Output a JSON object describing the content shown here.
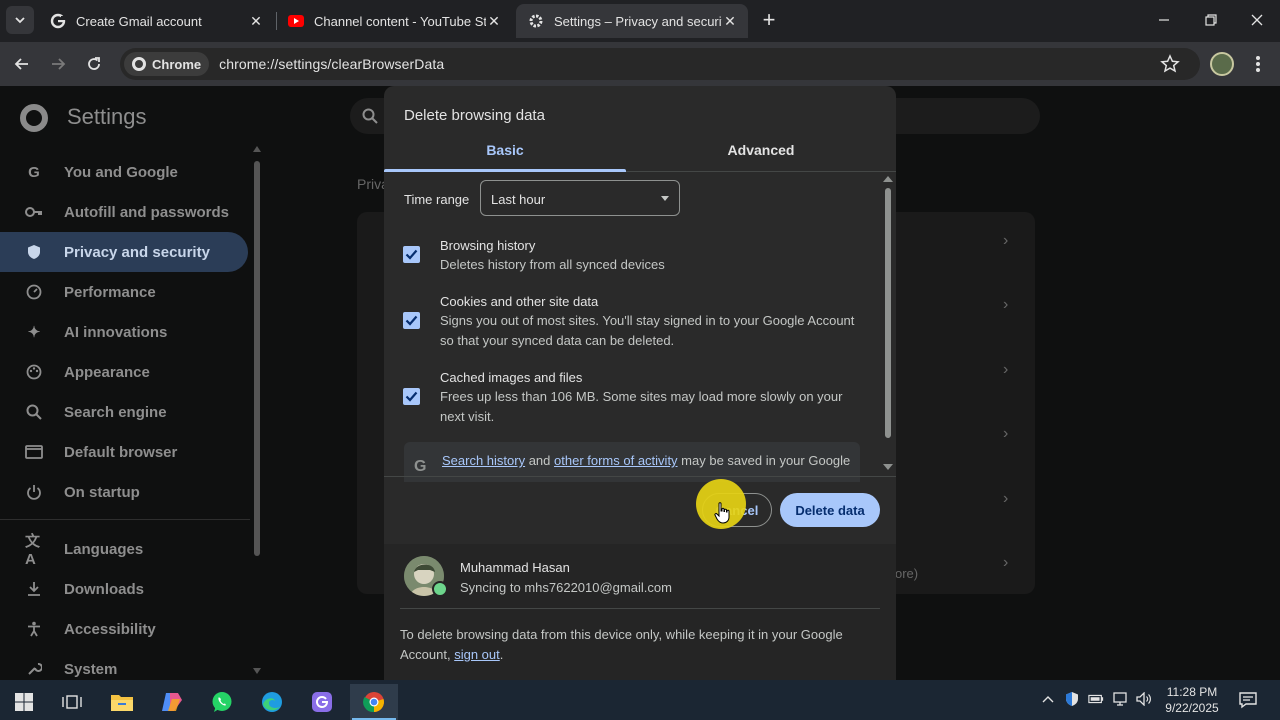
{
  "browser": {
    "tabs": [
      {
        "title": "Create Gmail account",
        "favicon": "google-g-icon",
        "active": false
      },
      {
        "title": "Channel content - YouTube Studio",
        "favicon": "youtube-icon",
        "active": false
      },
      {
        "title": "Settings – Privacy and security",
        "favicon": "gear-icon",
        "active": true
      }
    ],
    "chip_label": "Chrome",
    "url": "chrome://settings/clearBrowserData"
  },
  "settings": {
    "title": "Settings",
    "sidebar": [
      {
        "label": "You and Google",
        "icon": "google-g-icon"
      },
      {
        "label": "Autofill and passwords",
        "icon": "key-icon"
      },
      {
        "label": "Privacy and security",
        "icon": "shield-icon",
        "active": true
      },
      {
        "label": "Performance",
        "icon": "speedometer-icon"
      },
      {
        "label": "AI innovations",
        "icon": "sparkle-icon"
      },
      {
        "label": "Appearance",
        "icon": "palette-icon"
      },
      {
        "label": "Search engine",
        "icon": "search-icon"
      },
      {
        "label": "Default browser",
        "icon": "browser-window-icon"
      },
      {
        "label": "On startup",
        "icon": "power-icon"
      },
      {
        "label": "Languages",
        "icon": "translate-icon"
      },
      {
        "label": "Downloads",
        "icon": "download-icon"
      },
      {
        "label": "Accessibility",
        "icon": "accessibility-icon"
      },
      {
        "label": "System",
        "icon": "wrench-icon"
      }
    ],
    "section_heading_partial": "Priva",
    "card_more_partial": "ore)"
  },
  "dialog": {
    "title": "Delete browsing data",
    "tabs": {
      "basic": "Basic",
      "advanced": "Advanced"
    },
    "time_range_label": "Time range",
    "time_range_value": "Last hour",
    "options": [
      {
        "title": "Browsing history",
        "description": "Deletes history from all synced devices",
        "checked": true
      },
      {
        "title": "Cookies and other site data",
        "description": "Signs you out of most sites. You'll stay signed in to your Google Account so that your synced data can be deleted.",
        "checked": true
      },
      {
        "title": "Cached images and files",
        "description": "Frees up less than 106 MB. Some sites may load more slowly on your next visit.",
        "checked": true
      }
    ],
    "notice": {
      "link1": "Search history",
      "mid": " and ",
      "link2": "other forms of activity",
      "tail": " may be saved in your Google"
    },
    "cancel_label": "Cancel",
    "delete_label": "Delete data",
    "account": {
      "name": "Muhammad Hasan",
      "sync": "Syncing to mhs7622010@gmail.com"
    },
    "footer": {
      "text": "To delete browsing data from this device only, while keeping it in your Google Account, ",
      "link": "sign out",
      "end": "."
    }
  },
  "taskbar": {
    "apps": [
      "windows-start-icon",
      "task-view-icon",
      "file-explorer-icon",
      "copilot-icon",
      "whatsapp-icon",
      "edge-icon",
      "gmail-app-icon",
      "chrome-icon"
    ],
    "time": "11:28 PM",
    "date": "9/22/2025"
  },
  "colors": {
    "accent": "#a8c7fa",
    "dialog_bg": "#2a2a2a",
    "cursor_highlight": "#e6d214"
  }
}
